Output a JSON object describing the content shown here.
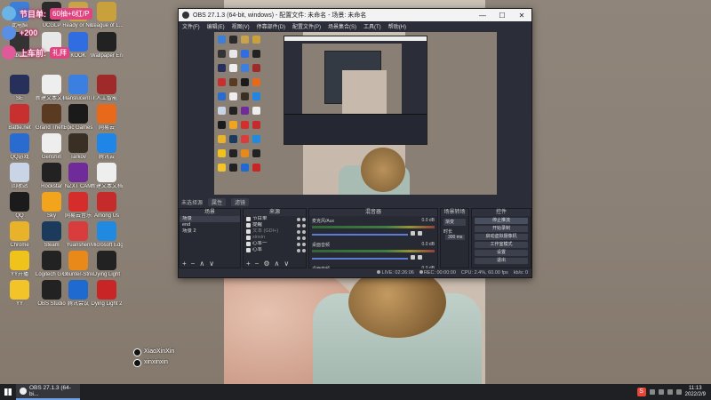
{
  "desktop": {
    "banner": {
      "line1_prefix": "节目单:",
      "line1_highlight": "60抽+6红/P",
      "line2": "+200",
      "line3_prefix": "上车前:",
      "line3_highlight": "礼拜"
    },
    "icons": [
      {
        "label": "此电脑",
        "color": "#3b7fd6"
      },
      {
        "label": "UCGLP",
        "color": "#2a2a2a"
      },
      {
        "label": "Ready or Not",
        "color": "#c9a34a"
      },
      {
        "label": "League of L...",
        "color": "#c8a13c"
      },
      {
        "label": "Rainbow Six",
        "color": "#333"
      },
      {
        "label": "",
        "color": "#e8e8e8"
      },
      {
        "label": "KOOK",
        "color": "#2f6de0"
      },
      {
        "label": "Wallpaper Engine",
        "color": "#222"
      },
      {
        "label": "SE",
        "color": "#27305a"
      },
      {
        "label": "新建文本文档",
        "color": "#eee"
      },
      {
        "label": "TranslucentTB",
        "color": "#3b80e0"
      },
      {
        "label": "人工智能",
        "color": "#a02a2a"
      },
      {
        "label": "Battle.net",
        "color": "#c83030"
      },
      {
        "label": "Grand Theft Auto V",
        "color": "#5a3a20"
      },
      {
        "label": "Epic Games",
        "color": "#1a1a1a"
      },
      {
        "label": "网易云",
        "color": "#e8691a"
      },
      {
        "label": "QQ游戏",
        "color": "#2a6bd0"
      },
      {
        "label": "Genshin",
        "color": "#eee"
      },
      {
        "label": "Tarkov",
        "color": "#3a2f25"
      },
      {
        "label": "腾讯云",
        "color": "#1f86e8"
      },
      {
        "label": "回收站",
        "color": "#c9d4e6"
      },
      {
        "label": "Rockstar",
        "color": "#222"
      },
      {
        "label": "NZXT CAM",
        "color": "#702a9a"
      },
      {
        "label": "新建文本文档",
        "color": "#eee"
      },
      {
        "label": "QQ",
        "color": "#1b1b1b"
      },
      {
        "label": "Sky",
        "color": "#f2a41c"
      },
      {
        "label": "网易云音乐",
        "color": "#d52c2c"
      },
      {
        "label": "Among Us",
        "color": "#c62b2b"
      },
      {
        "label": "Chrome",
        "color": "#e8b32a"
      },
      {
        "label": "Steam",
        "color": "#1b3a5c"
      },
      {
        "label": "Yuanshen",
        "color": "#d83c3c"
      },
      {
        "label": "Microsoft Edge",
        "color": "#1f8ae0"
      },
      {
        "label": "YY开播",
        "color": "#f0c21c"
      },
      {
        "label": "Logitech G HUB",
        "color": "#222"
      },
      {
        "label": "Counter-Strike",
        "color": "#e8891a"
      },
      {
        "label": "Dying Light",
        "color": "#222"
      },
      {
        "label": "YY",
        "color": "#f2c42a"
      },
      {
        "label": "OBS Studio",
        "color": "#222"
      },
      {
        "label": "腾讯会议",
        "color": "#1f6ad0"
      },
      {
        "label": "Dying Light 2",
        "color": "#c82626"
      }
    ],
    "watermark": {
      "line1": "XiaoXinXin",
      "line2": "xinxinxin"
    }
  },
  "obs": {
    "title": "OBS 27.1.3 (64-bit, windows) - 配置文件: 未命名 - 场景: 未命名",
    "window_buttons": [
      "—",
      "☐",
      "✕"
    ],
    "menu": [
      "文件(F)",
      "编辑(E)",
      "视图(V)",
      "停靠部件(D)",
      "配置文件(P)",
      "场景集合(S)",
      "工具(T)",
      "帮助(H)"
    ],
    "dockbar": {
      "label": "未选择源",
      "properties": "属性",
      "filters": "滤镜"
    },
    "scenes": {
      "header": "场景",
      "items": [
        "场景",
        "end",
        "场景 2"
      ],
      "selected_index": 0
    },
    "sources": {
      "header": "来源",
      "items": [
        "节目单",
        "提醒",
        "文本 (GDI+)",
        "xinxin",
        "心率一",
        "心率"
      ]
    },
    "mixer": {
      "header": "混音器",
      "channels": [
        {
          "name": "麦克风/Aux",
          "db": "0.0 dB"
        },
        {
          "name": "桌面音频",
          "db": "0.0 dB"
        },
        {
          "name": "桌面音频",
          "db": "0.0 dB"
        }
      ]
    },
    "transitions": {
      "header": "场景转场",
      "selected": "渐变",
      "duration_label": "时长",
      "duration_value": "300 ms"
    },
    "controls": {
      "header": "控件",
      "buttons": [
        "停止推流",
        "开始录制",
        "启动虚拟摄像机",
        "工作室模式",
        "设置",
        "退出"
      ],
      "active_index": 0
    },
    "status": {
      "live": "LIVE: 02:26:06",
      "rec": "REC: 00:00:00",
      "cpu": "CPU: 2.4%, 60.00 fps",
      "kbps": "kb/s: 0"
    }
  },
  "taskbar": {
    "active_app": "OBS 27.1.3 (64-bi...",
    "ime": "S",
    "time": "11:13",
    "date": "2022/2/9"
  }
}
